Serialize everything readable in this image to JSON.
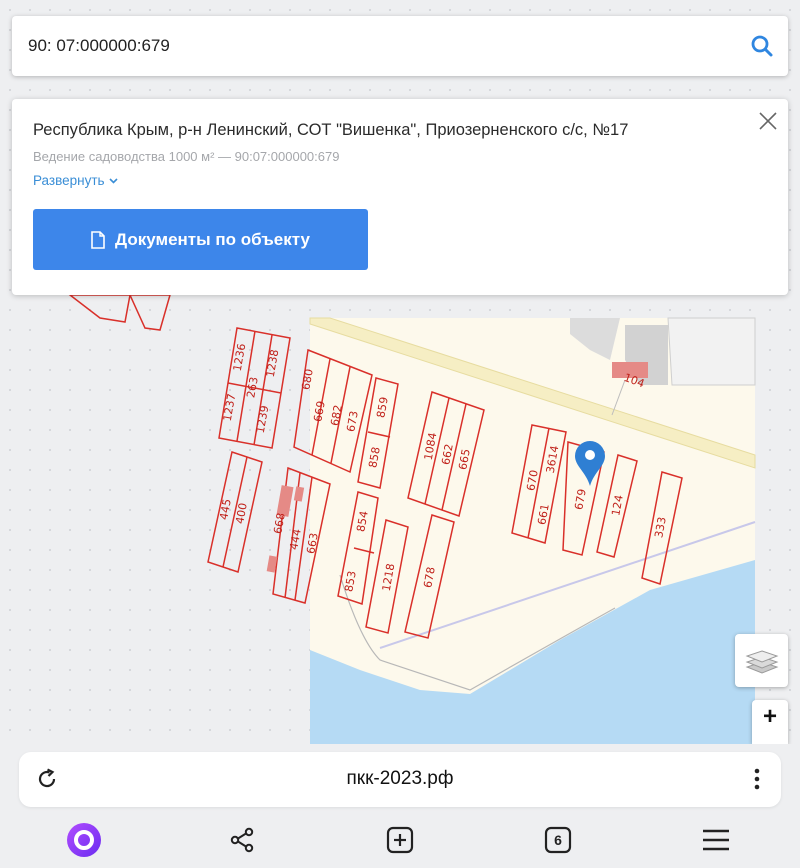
{
  "search": {
    "value": "90: 07:000000:679"
  },
  "card": {
    "address": "Республика Крым, р-н Ленинский, СОТ \"Вишенка\", Приозерненского с/с, №17",
    "subtitle": "Ведение садоводства 1000 м² — 90:07:000000:679",
    "expand_label": "Развернуть",
    "button_label": "Документы по объекту"
  },
  "map": {
    "plot_labels": [
      "1236",
      "263",
      "1238",
      "1237",
      "1239",
      "680",
      "669",
      "682",
      "673",
      "859",
      "858",
      "1084",
      "662",
      "665",
      "445",
      "400",
      "668",
      "444",
      "663",
      "854",
      "853",
      "1218",
      "678",
      "670",
      "3614",
      "661",
      "679",
      "124",
      "333",
      "104"
    ],
    "selected_plot": "679",
    "colors": {
      "plot_outline": "#d9302a",
      "water": "#b5daf4",
      "land": "#fdf9ec",
      "road": "#f6eec4",
      "marker": "#2f7fd3"
    }
  },
  "controls": {
    "zoom_in_label": "+"
  },
  "browser": {
    "url": "пкк-2023.рф",
    "tab_count": "6"
  }
}
